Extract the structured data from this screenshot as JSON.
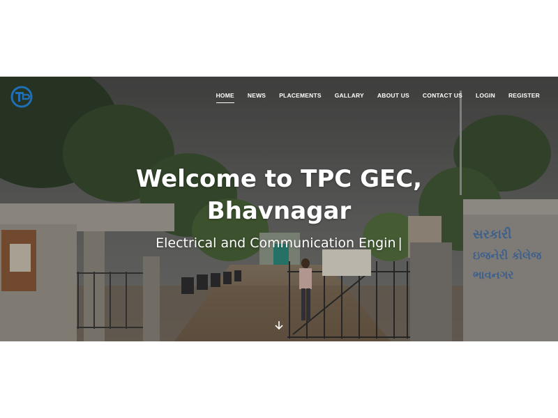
{
  "nav": {
    "items": [
      {
        "label": "HOME",
        "active": true
      },
      {
        "label": "NEWS",
        "active": false
      },
      {
        "label": "PLACEMENTS",
        "active": false
      },
      {
        "label": "GALLARY",
        "active": false
      },
      {
        "label": "ABOUT US",
        "active": false
      },
      {
        "label": "CONTACT US",
        "active": false
      },
      {
        "label": "LOGIN",
        "active": false
      },
      {
        "label": "REGISTER",
        "active": false
      }
    ]
  },
  "hero": {
    "title_line1": "Welcome to TPC GEC,",
    "title_line2": "Bhavnagar",
    "typed_text": "Electrical and Communication Engin",
    "typed_cursor": "|",
    "gate_sign_line1": "સરકારી",
    "gate_sign_line2": "ઇજનેરી કોલેજ",
    "gate_sign_line3": "ભાવનગર"
  },
  "icons": {
    "logo": "college-logo-icon",
    "scroll": "arrow-down-icon"
  },
  "colors": {
    "logo_blue": "#1e6fb5",
    "text": "#ffffff"
  }
}
